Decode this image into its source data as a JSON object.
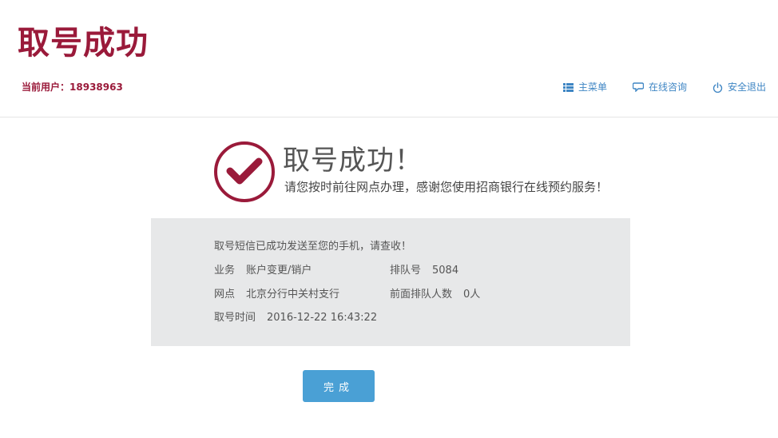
{
  "header": {
    "title": "取号成功",
    "user_label": "当前用户：",
    "user_value": "18938963",
    "nav": [
      {
        "label": "主菜单",
        "icon": "list-icon"
      },
      {
        "label": "在线咨询",
        "icon": "chat-bubble-icon"
      },
      {
        "label": "安全退出",
        "icon": "power-icon"
      }
    ]
  },
  "result": {
    "heading": "取号成功！",
    "subtitle": "请您按时前往网点办理，感谢您使用招商银行在线预约服务！"
  },
  "details": {
    "sms_notice": "取号短信已成功发送至您的手机，请查收！",
    "business_label": "业务",
    "business_value": "账户变更/销户",
    "queue_label": "排队号",
    "queue_value": "5084",
    "branch_label": "网点",
    "branch_value": "北京分行中关村支行",
    "ahead_label": "前面排队人数",
    "ahead_value": "0人",
    "time_label": "取号时间",
    "time_value": "2016-12-22 16:43:22"
  },
  "actions": {
    "done_label": "完成"
  },
  "colors": {
    "brand": "#9a1a3a",
    "link": "#3f86c4",
    "button": "#4aa0d5",
    "panel": "#e7e8e9"
  }
}
